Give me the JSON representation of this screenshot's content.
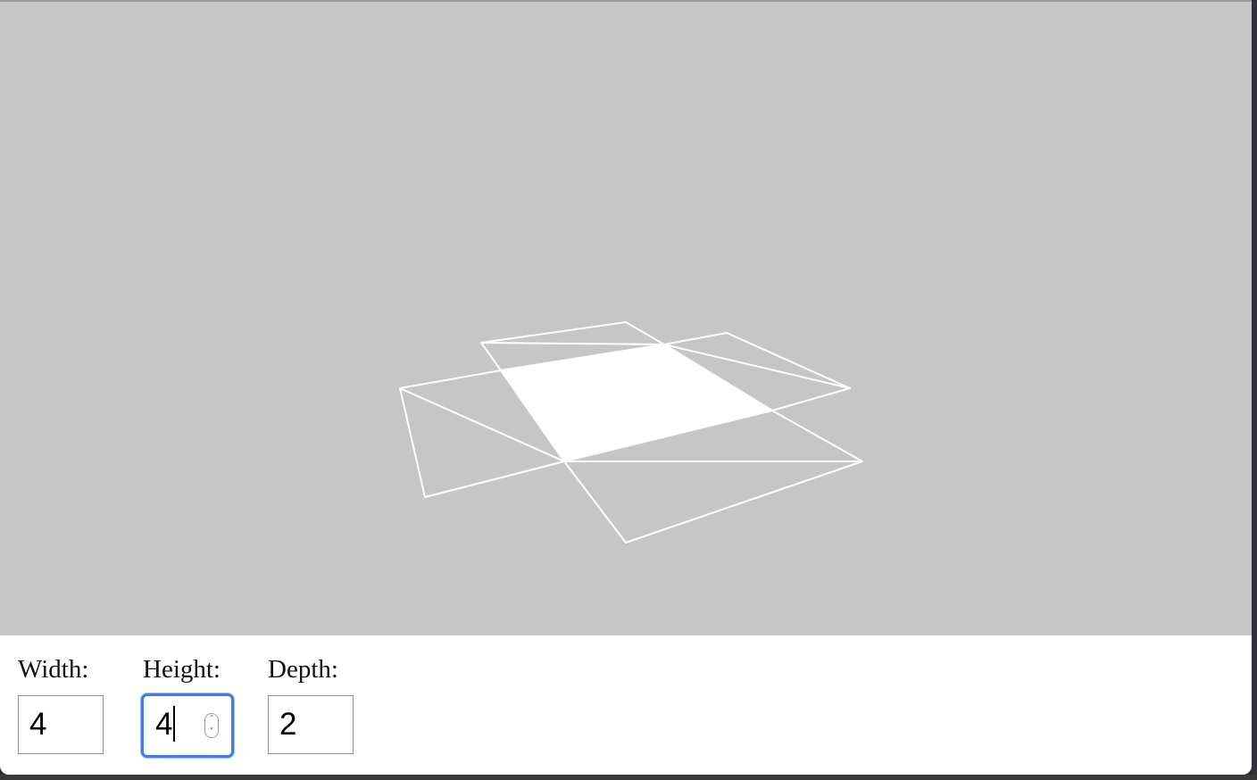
{
  "viewport": {
    "background": "#c6c6c6",
    "edge_color": "#ffffff",
    "filled_face_color": "#ffffff"
  },
  "controls": {
    "width": {
      "label": "Width:",
      "value": "4"
    },
    "height": {
      "label": "Height:",
      "value": "4",
      "focused": true
    },
    "depth": {
      "label": "Depth:",
      "value": "2"
    }
  },
  "accent_color": "#3d7fe6"
}
